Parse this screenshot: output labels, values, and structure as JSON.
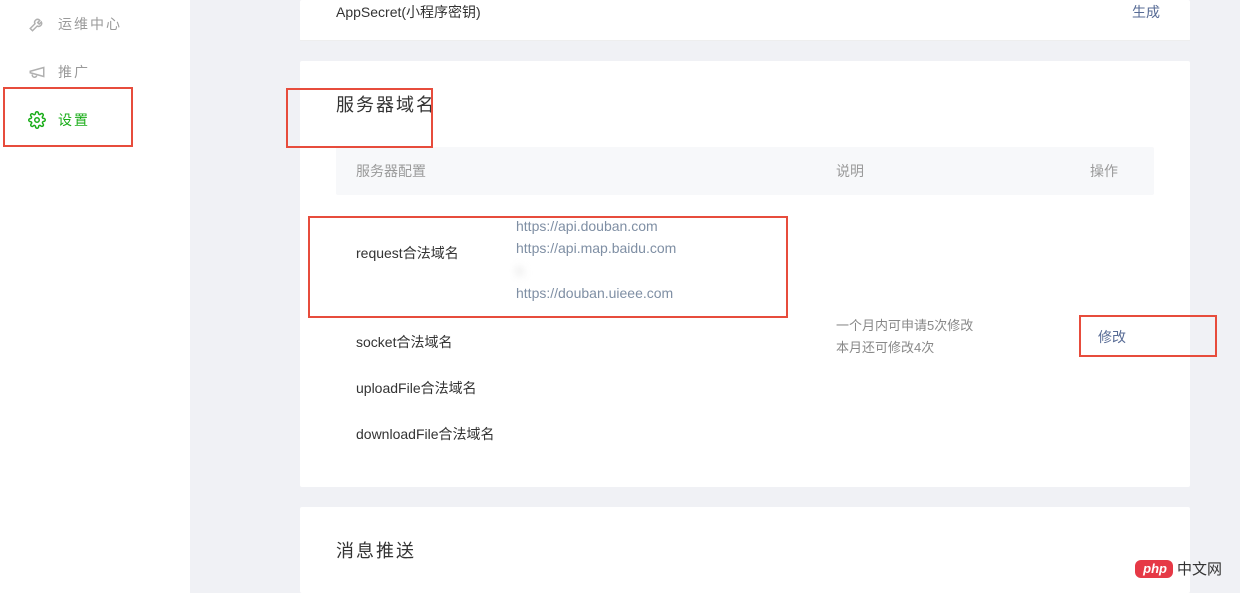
{
  "sidebar": {
    "items": [
      {
        "label": "运维中心",
        "icon": "wrench"
      },
      {
        "label": "推广",
        "icon": "megaphone"
      },
      {
        "label": "设置",
        "icon": "gear"
      }
    ]
  },
  "top": {
    "appsecret_label": "AppSecret(小程序密钥)",
    "generate": "生成"
  },
  "domain_card": {
    "title": "服务器域名",
    "headers": {
      "config": "服务器配置",
      "desc": "说明",
      "action": "操作"
    },
    "rows": {
      "request": {
        "label": "request合法域名",
        "values": [
          "https://api.douban.com",
          "https://api.map.baidu.com",
          "h",
          "https://douban.uieee.com"
        ]
      },
      "socket": {
        "label": "socket合法域名"
      },
      "upload": {
        "label": "uploadFile合法域名"
      },
      "download": {
        "label": "downloadFile合法域名"
      }
    },
    "desc": {
      "line1": "一个月内可申请5次修改",
      "line2": "本月还可修改4次"
    },
    "action": "修改"
  },
  "push_card": {
    "title": "消息推送"
  },
  "watermark": {
    "badge": "php",
    "text": "中文网"
  }
}
